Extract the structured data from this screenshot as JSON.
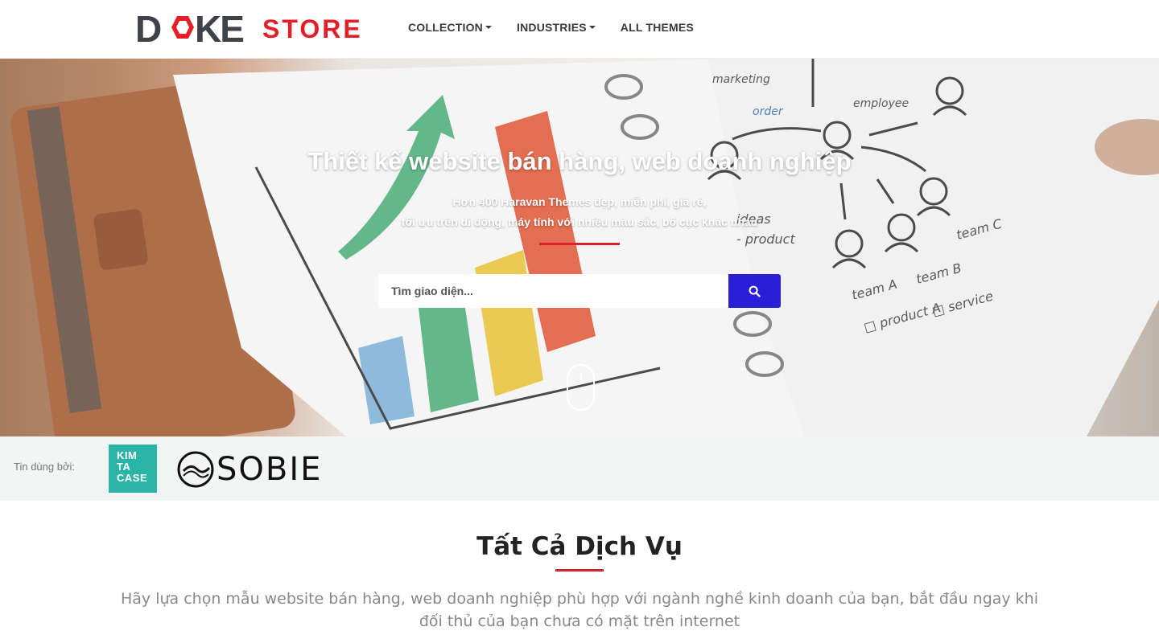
{
  "header": {
    "logo_word": "DOKE",
    "logo_store": "STORE",
    "nav": [
      {
        "label": "COLLECTION",
        "has_dropdown": true
      },
      {
        "label": "INDUSTRIES",
        "has_dropdown": true
      },
      {
        "label": "ALL THEMES",
        "has_dropdown": false
      }
    ]
  },
  "hero": {
    "title": "Thiết kế website bán hàng, web doanh nghiệp",
    "subtitle_line1": "Hơn 400 Haravan Themes đẹp, miễn phí, giá rẻ,",
    "subtitle_line2": "tối ưu trên di động, máy tính với nhiều màu sắc, bố cục khác nhau",
    "search_placeholder": "Tìm giao diện...",
    "search_icon": "search-icon",
    "scroll_icon": "mouse-scroll-icon"
  },
  "trusted": {
    "label": "Tin dùng bởi:",
    "brands": [
      {
        "name": "KIM TA CASE",
        "lines": [
          "KIM",
          "TA",
          "CASE"
        ],
        "color": "#2bb5a7"
      },
      {
        "name": "SOBIE"
      }
    ]
  },
  "services": {
    "title": "Tất Cả Dịch Vụ",
    "description": "Hãy lựa chọn mẫu website bán hàng, web doanh nghiệp phù hợp với ngành nghề kinh doanh của bạn, bắt đầu ngay khi đối thủ của bạn chưa có mặt trên internet"
  },
  "colors": {
    "brand_red": "#e32027",
    "search_button": "#2a1fd6",
    "accent_line": "#d9232a"
  }
}
